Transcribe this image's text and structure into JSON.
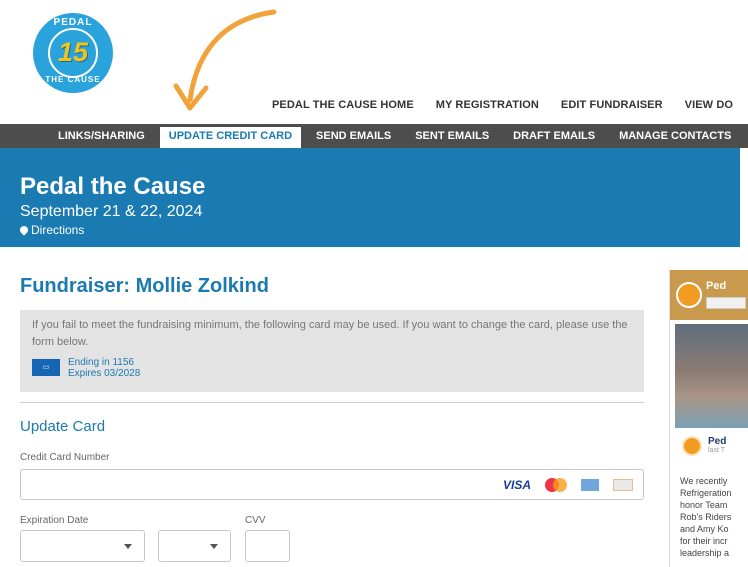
{
  "logo": {
    "top_text": "PEDAL",
    "number": "15",
    "bottom_text": "THE CAUSE"
  },
  "topnav": [
    "PEDAL THE CAUSE HOME",
    "MY REGISTRATION",
    "EDIT FUNDRAISER",
    "VIEW DO"
  ],
  "subnav": [
    {
      "label": "LINKS/SHARING",
      "active": false
    },
    {
      "label": "UPDATE CREDIT CARD",
      "active": true
    },
    {
      "label": "SEND EMAILS",
      "active": false
    },
    {
      "label": "SENT EMAILS",
      "active": false
    },
    {
      "label": "DRAFT EMAILS",
      "active": false
    },
    {
      "label": "MANAGE CONTACTS",
      "active": false
    }
  ],
  "banner": {
    "title": "Pedal the Cause",
    "date": "September 21 & 22, 2024",
    "directions": "Directions"
  },
  "main": {
    "fundraiser_title": "Fundraiser: Mollie Zolkind",
    "notice": "If you fail to meet the fundraising minimum, the following card may be used. If you want to change the card, please use the form below.",
    "card_ending": "Ending in 1156",
    "card_expires": "Expires 03/2028",
    "update_title": "Update Card",
    "cc_label": "Credit Card Number",
    "cc_value": "",
    "visa_label": "VISA",
    "exp_label": "Expiration Date",
    "cvv_label": "CVV",
    "exp_month": "",
    "exp_year": "",
    "cvv_value": ""
  },
  "facebook": {
    "page_name": "Ped",
    "post_name": "Ped",
    "post_sub": "last T",
    "post_text": [
      "We recently",
      "Refrigeration",
      "honor Team",
      "Rob's Riders",
      "and Amy Ko",
      "for their incr",
      "leadership a"
    ]
  },
  "colors": {
    "brand_blue": "#1a7bb3",
    "nav_dark": "#4d4d4d",
    "arrow_orange": "#f2a23a"
  }
}
